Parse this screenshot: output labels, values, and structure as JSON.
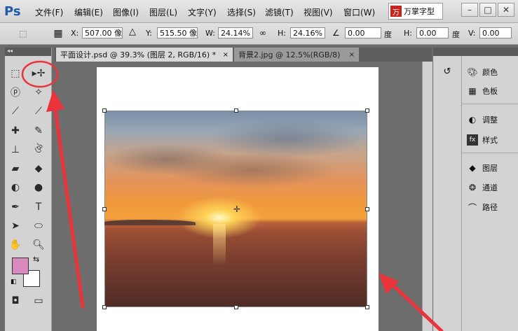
{
  "app": {
    "logo": "Ps",
    "brand_badge_icon": "万",
    "brand_badge": "万掌字型"
  },
  "menu": [
    "文件(F)",
    "编辑(E)",
    "图像(I)",
    "图层(L)",
    "文字(Y)",
    "选择(S)",
    "滤镜(T)",
    "视图(V)",
    "窗口(W)"
  ],
  "window_controls": {
    "minimize": "–",
    "maximize": "□",
    "close": "✕"
  },
  "options": {
    "x_label": "X:",
    "x_value": "507.00 像素",
    "y_label": "Y:",
    "y_value": "515.50 像素",
    "w_label": "W:",
    "w_value": "24.14%",
    "h_label": "H:",
    "h_value": "24.16%",
    "angle_value": "0.00",
    "angle_unit": "度",
    "hskew_label": "H:",
    "hskew_value": "0.00",
    "hskew_unit": "度",
    "v_label": "V:",
    "v_value": "0.00"
  },
  "tabs": [
    {
      "label": "平面设计.psd @ 39.3% (图层 2, RGB/16) *",
      "close": "×"
    },
    {
      "label": "背景2.jpg @ 12.5%(RGB/8)",
      "close": "×"
    }
  ],
  "panels": [
    "颜色",
    "色板",
    "调整",
    "样式",
    "图层",
    "通道",
    "路径"
  ],
  "colors": {
    "foreground": "#d98bbf",
    "background": "#ffffff",
    "annotation": "#e8343a"
  }
}
